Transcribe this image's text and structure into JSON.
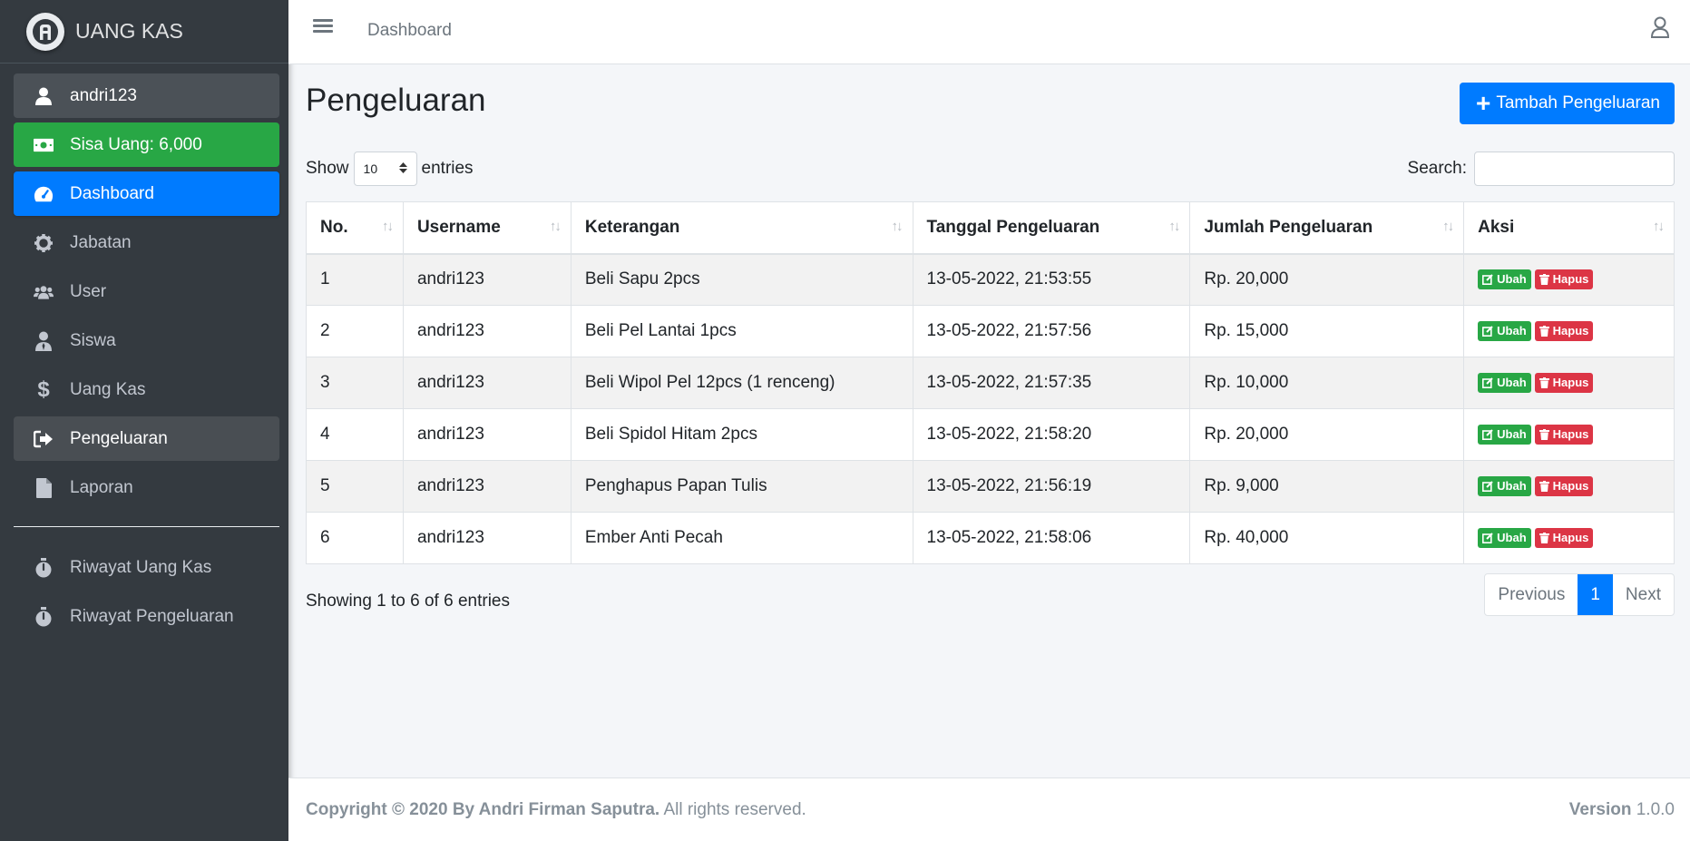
{
  "brand": {
    "name": "UANG KAS"
  },
  "sidebar": {
    "user": "andri123",
    "balance": "Sisa Uang: 6,000",
    "items": [
      {
        "label": "Dashboard",
        "icon": "tachometer-icon"
      },
      {
        "label": "Jabatan",
        "icon": "gear-icon"
      },
      {
        "label": "User",
        "icon": "users-icon"
      },
      {
        "label": "Siswa",
        "icon": "student-icon"
      },
      {
        "label": "Uang Kas",
        "icon": "dollar-icon"
      },
      {
        "label": "Pengeluaran",
        "icon": "sign-out-icon"
      },
      {
        "label": "Laporan",
        "icon": "file-icon"
      }
    ],
    "history": [
      {
        "label": "Riwayat Uang Kas",
        "icon": "stopwatch-icon"
      },
      {
        "label": "Riwayat Pengeluaran",
        "icon": "stopwatch-icon"
      }
    ]
  },
  "header": {
    "link": "Dashboard"
  },
  "page": {
    "title": "Pengeluaran",
    "add_button": "Tambah Pengeluaran",
    "show_label": "Show",
    "entries_value": "10",
    "entries_label": "entries",
    "search_label": "Search:",
    "search_value": ""
  },
  "table": {
    "columns": [
      "No.",
      "Username",
      "Keterangan",
      "Tanggal Pengeluaran",
      "Jumlah Pengeluaran",
      "Aksi"
    ],
    "edit_label": "Ubah",
    "delete_label": "Hapus",
    "rows": [
      [
        "1",
        "andri123",
        "Beli Sapu 2pcs",
        "13-05-2022, 21:53:55",
        "Rp. 20,000"
      ],
      [
        "2",
        "andri123",
        "Beli Pel Lantai 1pcs",
        "13-05-2022, 21:57:56",
        "Rp. 15,000"
      ],
      [
        "3",
        "andri123",
        "Beli Wipol Pel 12pcs (1 renceng)",
        "13-05-2022, 21:57:35",
        "Rp. 10,000"
      ],
      [
        "4",
        "andri123",
        "Beli Spidol Hitam 2pcs",
        "13-05-2022, 21:58:20",
        "Rp. 20,000"
      ],
      [
        "5",
        "andri123",
        "Penghapus Papan Tulis",
        "13-05-2022, 21:56:19",
        "Rp. 9,000"
      ],
      [
        "6",
        "andri123",
        "Ember Anti Pecah",
        "13-05-2022, 21:58:06",
        "Rp. 40,000"
      ]
    ]
  },
  "pagination": {
    "info": "Showing 1 to 6 of 6 entries",
    "previous": "Previous",
    "current": "1",
    "next": "Next"
  },
  "footer": {
    "copyright": "Copyright © 2020 By Andri Firman Saputra.",
    "rights": " All rights reserved.",
    "version_label": "Version",
    "version": " 1.0.0"
  },
  "colors": {
    "sidebar_bg": "#343a40",
    "primary": "#007bff",
    "success": "#28a745",
    "danger": "#dc3545"
  }
}
